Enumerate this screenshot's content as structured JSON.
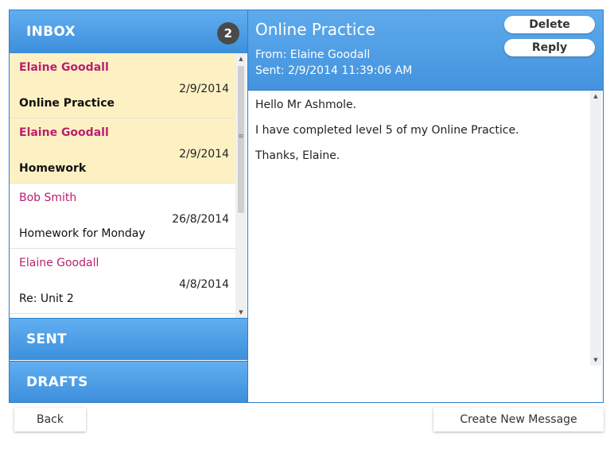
{
  "folders": {
    "inbox": {
      "label": "INBOX",
      "unread_count": "2"
    },
    "sent": {
      "label": "SENT"
    },
    "drafts": {
      "label": "DRAFTS"
    }
  },
  "messages": [
    {
      "sender": "Elaine Goodall",
      "date": "2/9/2014",
      "subject": "Online Practice",
      "unread": true
    },
    {
      "sender": "Elaine Goodall",
      "date": "2/9/2014",
      "subject": "Homework",
      "unread": true
    },
    {
      "sender": "Bob Smith",
      "date": "26/8/2014",
      "subject": "Homework for Monday",
      "unread": false
    },
    {
      "sender": "Elaine Goodall",
      "date": "4/8/2014",
      "subject": "Re: Unit 2",
      "unread": false
    }
  ],
  "open_message": {
    "title": "Online Practice",
    "from": "From: Elaine Goodall",
    "sent": "Sent: 2/9/2014 11:39:06 AM",
    "body": [
      "Hello Mr Ashmole.",
      "I have completed level 5 of my Online Practice.",
      "Thanks, Elaine."
    ],
    "delete_label": "Delete",
    "reply_label": "Reply"
  },
  "footer": {
    "back_label": "Back",
    "new_message_label": "Create New Message"
  },
  "colors": {
    "header_blue": "#4393de",
    "unread_bg": "#fdf1c4",
    "sender_pink": "#b8206f"
  },
  "icons": {
    "scroll_up": "up-arrow-icon",
    "scroll_down": "down-arrow-icon",
    "grip": "grip-icon"
  }
}
